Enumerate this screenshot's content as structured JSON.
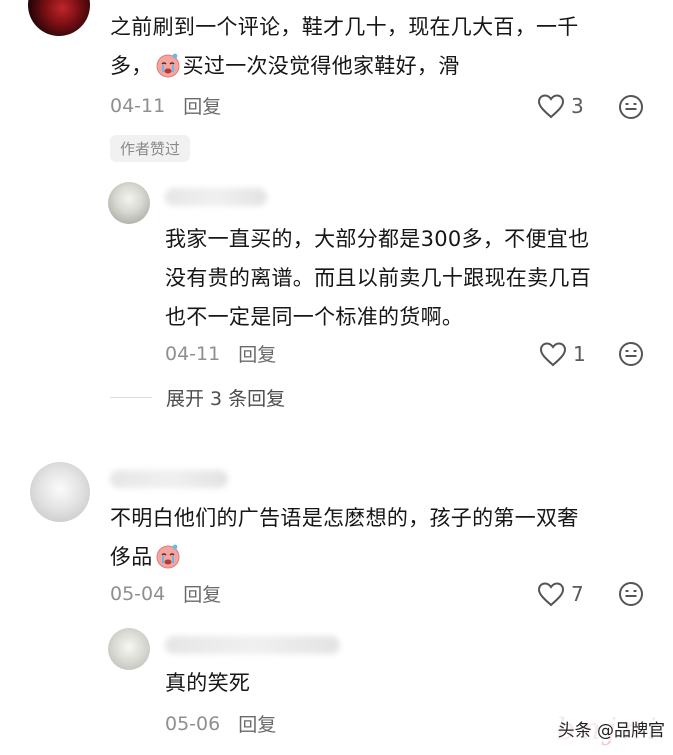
{
  "comments": [
    {
      "text_line1": "之前刷到一个评论，鞋才几十，现在几大百，一千",
      "text_line2_pre": "多，",
      "text_line2_post": "买过一次没觉得他家鞋好，滑",
      "date": "04-11",
      "reply_label": "回复",
      "likes": "3",
      "badge": "作者赞过",
      "inline_emoji": "crying-face-icon"
    },
    {
      "text_lines": [
        "我家一直买的，大部分都是300多，不便宜也",
        "没有贵的离谱。而且以前卖几十跟现在卖几百",
        "也不一定是同一个标准的货啊。"
      ],
      "date": "04-11",
      "reply_label": "回复",
      "likes": "1"
    },
    {
      "text_line1": "不明白他们的广告语是怎麽想的，孩子的第一双奢",
      "text_line2_pre": "侈品",
      "date": "05-04",
      "reply_label": "回复",
      "likes": "7",
      "inline_emoji": "crying-face-icon"
    },
    {
      "text_lines": [
        "真的笑死"
      ],
      "date": "05-06",
      "reply_label": "回复"
    }
  ],
  "expand_replies": "展开 3 条回复",
  "watermark": {
    "text": "头条 @品牌官",
    "script": "bnjni"
  },
  "colors": {
    "meta_gray": "#8f8f8f",
    "badge_bg": "#f1f1f1"
  }
}
